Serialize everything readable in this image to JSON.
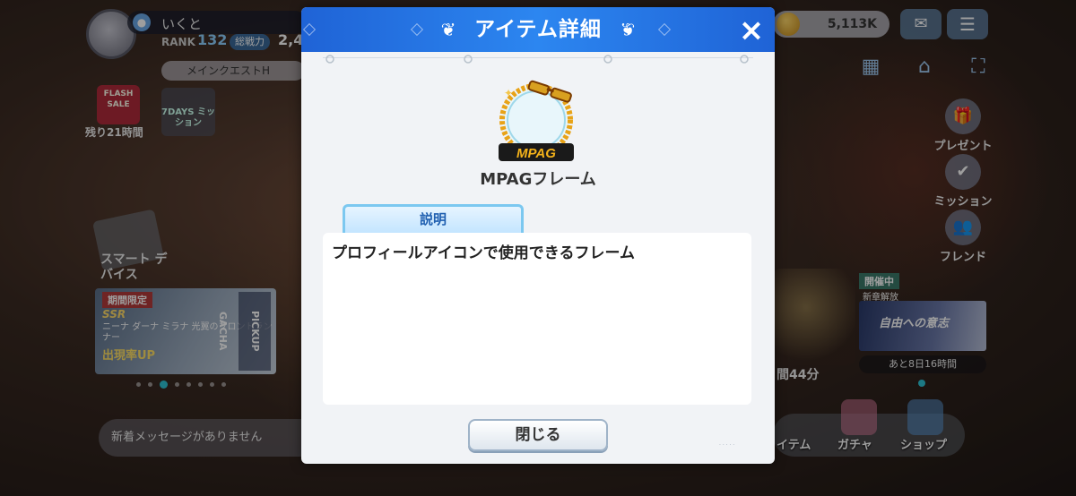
{
  "profile": {
    "username": "いくと",
    "rank_label": "RANK",
    "rank_value": "132",
    "power_label": "総戦力",
    "power_value": "2,4"
  },
  "quest": {
    "label": "メインクエストH"
  },
  "flash_sale": {
    "label": "FLASH SALE",
    "time_left": "残り21時間"
  },
  "days_mission": {
    "label": "7DAYS ミッション"
  },
  "smart_device": {
    "label": "スマート デバイス"
  },
  "pickup": {
    "tag": "期間限定",
    "rarity": "SSR",
    "characters": "ニーナ ダーナ ミラナ 光翼のフロントランナー",
    "rate_up": "出現率UP",
    "side_text": "PICKUP GACHA"
  },
  "message_bar": {
    "text": "新着メッセージがありません"
  },
  "currency": {
    "coins": "5,113K"
  },
  "side_menu": {
    "present": "プレゼント",
    "mission": "ミッション",
    "friend": "フレンド"
  },
  "event": {
    "tag": "開催中",
    "new_chapter": "新章解放",
    "title": "自由への意志",
    "time_left": "あと8日16時間",
    "remaining": "間44分"
  },
  "bottom_nav": {
    "item": "イテム",
    "gacha": "ガチャ",
    "shop": "ショップ"
  },
  "modal": {
    "title": "アイテム詳細",
    "item_name": "MPAGフレーム",
    "frame_logo": "MPAG",
    "tab_label": "説明",
    "description": "プロフィールアイコンで使用できるフレーム",
    "close_button": "閉じる",
    "close_icon": "×"
  },
  "colors": {
    "header_blue": "#2c86f0",
    "tab_border": "#7cc8f0",
    "accent_gold": "#e8a317"
  }
}
